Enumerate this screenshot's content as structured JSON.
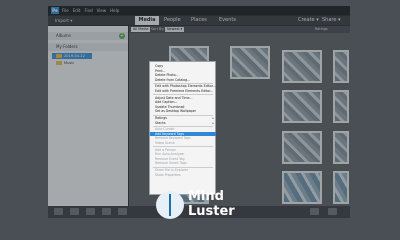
{
  "app": {
    "menus": [
      "File",
      "Edit",
      "Find",
      "View",
      "Help"
    ],
    "logo": "Pe"
  },
  "toolbar": {
    "import": "Import ▾",
    "tabs": {
      "media": "Media",
      "people": "People",
      "places": "Places",
      "events": "Events"
    },
    "create": "Create ▾",
    "share": "Share ▾"
  },
  "sidebar": {
    "albums": "Albums",
    "my_folders": "My Folders",
    "folders": [
      {
        "label": "2019-04-22",
        "selected": true
      },
      {
        "label": "Music",
        "selected": false
      }
    ]
  },
  "filterbar": {
    "all_media": "All Media",
    "sort_by": "Sort By:",
    "sort_value": "Newest ▾",
    "ratings": "Ratings"
  },
  "context_menu": {
    "items": [
      {
        "label": "Copy",
        "state": "normal"
      },
      {
        "label": "Print...",
        "state": "normal"
      },
      {
        "label": "Delete Photo...",
        "state": "normal"
      },
      {
        "label": "Delete from Catalog...",
        "state": "normal"
      },
      {
        "sep": true
      },
      {
        "label": "Edit with Photoshop Elements Editor...",
        "state": "normal"
      },
      {
        "label": "Edit with Premiere Elements Editor...",
        "state": "normal"
      },
      {
        "sep": true
      },
      {
        "label": "Adjust Date and Time...",
        "state": "normal"
      },
      {
        "label": "Add Caption...",
        "state": "normal"
      },
      {
        "label": "Update Thumbnail",
        "state": "normal"
      },
      {
        "label": "Set as Desktop Wallpaper",
        "state": "normal"
      },
      {
        "sep": true
      },
      {
        "label": "Ratings",
        "state": "normal",
        "arrow": true
      },
      {
        "label": "Stacks",
        "state": "normal",
        "arrow": true
      },
      {
        "sep": true
      },
      {
        "label": "Auto Curate",
        "state": "disabled"
      },
      {
        "label": "Add Keyword Tags",
        "state": "highlighted"
      },
      {
        "label": "Remove Keyword Tags",
        "state": "disabled"
      },
      {
        "label": "Video Scene",
        "state": "disabled"
      },
      {
        "sep": true
      },
      {
        "label": "Add a Person",
        "state": "disabled"
      },
      {
        "label": "Run Auto-Analyzer",
        "state": "disabled"
      },
      {
        "label": "Remove Event Tag",
        "state": "disabled"
      },
      {
        "label": "Remove Smart Tags",
        "state": "disabled"
      },
      {
        "sep": true
      },
      {
        "label": "Show File in Explorer",
        "state": "disabled"
      },
      {
        "label": "Show Properties",
        "state": "disabled"
      }
    ]
  },
  "brand": {
    "line1": "Mind",
    "line2": "Luster"
  },
  "colors": {
    "accent": "#2f87d6",
    "active_tab": "#e8ebee",
    "panel": "#e9ebee"
  }
}
